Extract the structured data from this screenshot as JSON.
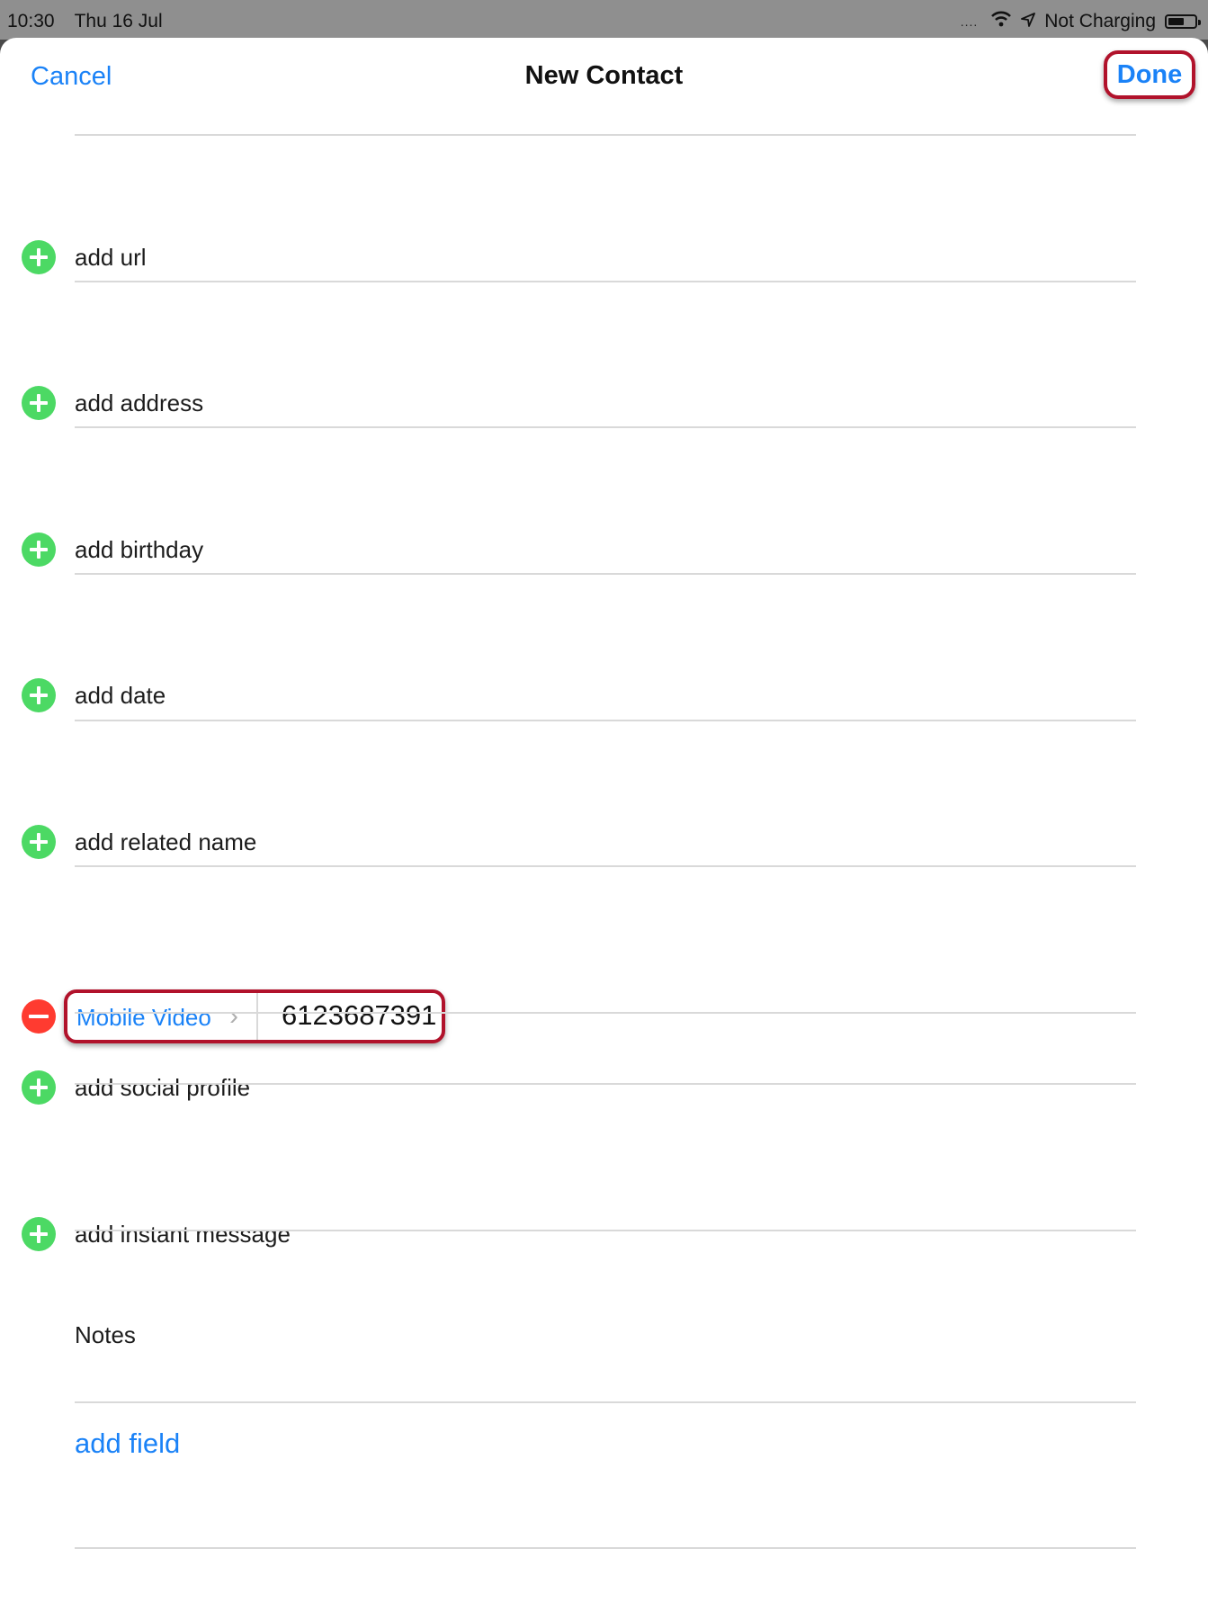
{
  "status_bar": {
    "time": "10:30",
    "date": "Thu 16 Jul",
    "signal_dots": "....",
    "charging": "Not Charging",
    "battery_level": 0.62
  },
  "nav": {
    "cancel_label": "Cancel",
    "title": "New Contact",
    "done_label": "Done"
  },
  "rows": {
    "url": "add url",
    "address": "add address",
    "birthday": "add birthday",
    "date": "add date",
    "related_name": "add related name",
    "social_profile": "add social profile",
    "instant_message": "add instant message"
  },
  "phone": {
    "type_label": "Mobile Video",
    "number": "6123687391"
  },
  "notes_label": "Notes",
  "add_field_label": "add field",
  "colors": {
    "accent": "#1a82f7",
    "add": "#4cd964",
    "remove": "#ff3b30",
    "highlight": "#b1122b"
  }
}
